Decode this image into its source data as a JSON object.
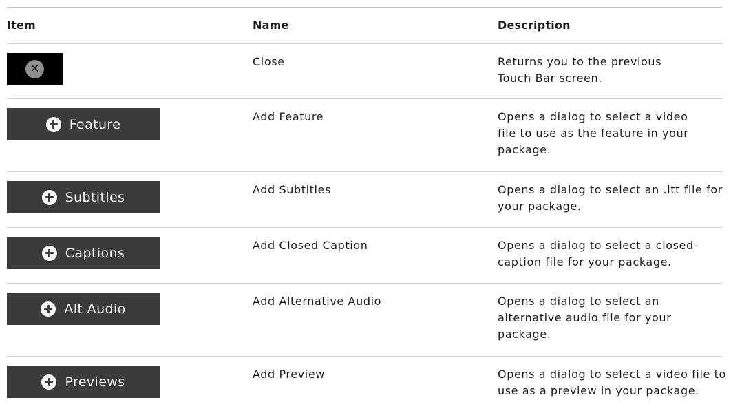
{
  "table": {
    "headers": {
      "item": "Item",
      "name": "Name",
      "description": "Description"
    },
    "rows": [
      {
        "button_label": "",
        "icon": "close-icon",
        "name": "Close",
        "description": "Returns you to the previous Touch Bar screen."
      },
      {
        "button_label": "Feature",
        "icon": "plus-circle-icon",
        "name": "Add Feature",
        "description": "Opens a dialog to select a video file to use as the feature in your package."
      },
      {
        "button_label": "Subtitles",
        "icon": "plus-circle-icon",
        "name": "Add Subtitles",
        "description": "Opens a dialog to select an .itt file for your package."
      },
      {
        "button_label": "Captions",
        "icon": "plus-circle-icon",
        "name": "Add Closed Caption",
        "description": "Opens a dialog to select a closed-caption file for your package."
      },
      {
        "button_label": "Alt Audio",
        "icon": "plus-circle-icon",
        "name": "Add Alternative Audio",
        "description": "Opens a dialog to select an alternative audio file for your package."
      },
      {
        "button_label": "Previews",
        "icon": "plus-circle-icon",
        "name": "Add Preview",
        "description": "Opens a dialog to select a video file to use as a preview in your package."
      }
    ]
  },
  "colors": {
    "touch_bar_button_bg": "#3b3b3b",
    "close_button_bg": "#000000",
    "close_circle": "#8e8e8e",
    "divider": "#d2d2d2"
  }
}
